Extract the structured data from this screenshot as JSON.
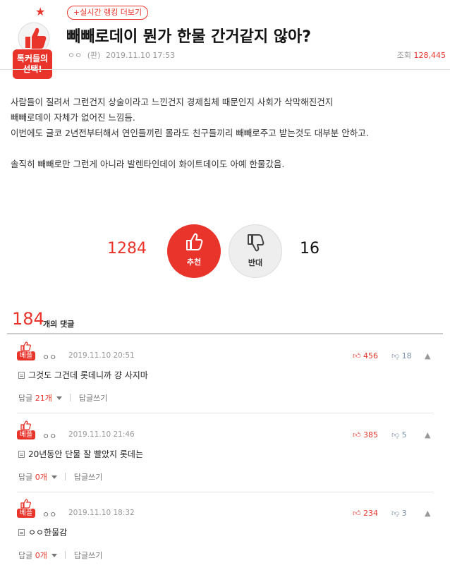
{
  "header": {
    "badge_line1": "톡커들의",
    "badge_line2": "선택!",
    "ranking_link": "+실시간 랭킹 더보기",
    "title": "빼빼로데이 뭔가 한물 간거같지 않아?",
    "author": "ㅇㅇ",
    "board": "(판)",
    "datetime": "2019.11.10 17:53",
    "views_label": "조회",
    "views_count": "128,445"
  },
  "post": {
    "lines": [
      "사람들이 질려서 그런건지 상술이라고 느낀건지 경제침체 때문인지 사회가 삭막해진건지",
      "빼빼로데이 자체가 없어진 느낌듬.",
      "이번에도 글코 2년전부터해서 연인들끼린 몰라도 친구들끼리 빼빼로주고 받는것도 대부분 안하고.",
      "",
      "솔직히 빼빼로만 그런게 아니라 발렌타인데이 화이트데이도 아예 한물갔음."
    ]
  },
  "votes": {
    "up_count": "1284",
    "up_label": "추천",
    "down_count": "16",
    "down_label": "반대"
  },
  "comments_header": {
    "count": "184",
    "label": "개의 댓글"
  },
  "comments": [
    {
      "best_tag": "베플",
      "author": "ㅇㅇ",
      "date": "2019.11.10 20:51",
      "likes": "456",
      "dislikes": "18",
      "text": "그것도 그건데 롯데니까 걍 사지마",
      "reply_label": "답글",
      "reply_count": "21",
      "reply_unit": "개",
      "write_reply": "답글쓰기"
    },
    {
      "best_tag": "베플",
      "author": "ㅇㅇ",
      "date": "2019.11.10 21:46",
      "likes": "385",
      "dislikes": "5",
      "text": "20년동안 단물 잘 빨았지 롯데는",
      "reply_label": "답글",
      "reply_count": "0",
      "reply_unit": "개",
      "write_reply": "답글쓰기"
    },
    {
      "best_tag": "베플",
      "author": "ㅇㅇ",
      "date": "2019.11.10 18:32",
      "likes": "234",
      "dislikes": "3",
      "text": "ㅇㅇ한물감",
      "reply_label": "답글",
      "reply_count": "0",
      "reply_unit": "개",
      "write_reply": "답글쓰기"
    }
  ],
  "colors": {
    "accent": "#e8342a",
    "muted": "#999999"
  }
}
